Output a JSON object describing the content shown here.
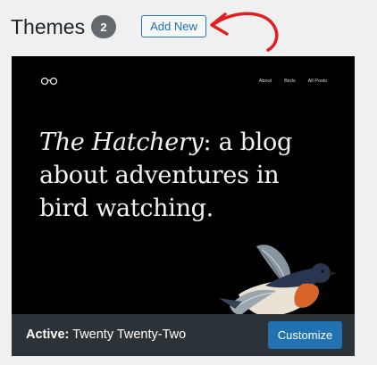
{
  "header": {
    "title": "Themes",
    "count": "2",
    "add_new_label": "Add New"
  },
  "theme": {
    "site": {
      "nav": [
        "About",
        "Birds",
        "All Posts"
      ],
      "headline_italic": "The Hatchery",
      "headline_rest": ": a blog about adventures in bird watching."
    },
    "footer": {
      "active_label": "Active:",
      "theme_name": "Twenty Twenty-Two",
      "customize_label": "Customize"
    }
  },
  "colors": {
    "accent": "#2271b1",
    "annotation_arrow": "#e02020",
    "footer_bg": "#2c3338"
  },
  "icons": [
    "binoculars-logo-icon",
    "annotation-arrow-icon",
    "bird-illustration"
  ]
}
